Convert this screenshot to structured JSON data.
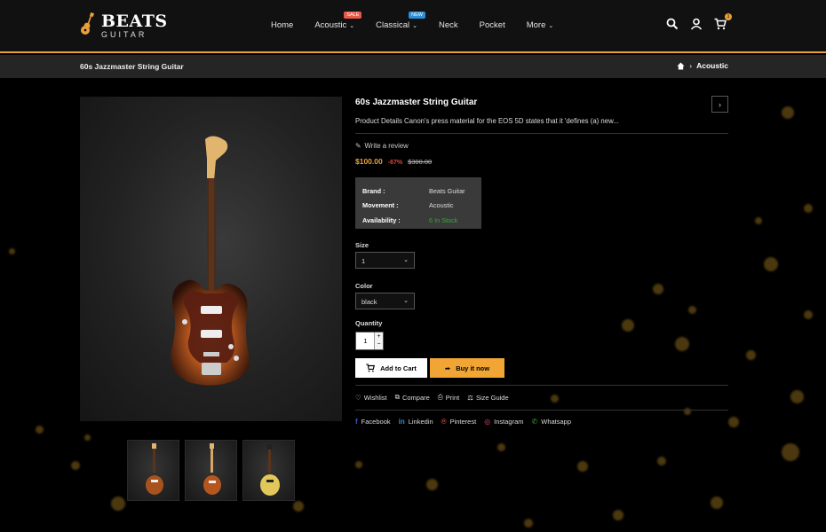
{
  "brand": {
    "name_top": "BEATS",
    "name_bottom": "GUITAR"
  },
  "nav": {
    "items": [
      {
        "label": "Home"
      },
      {
        "label": "Acoustic",
        "badge": "Sale"
      },
      {
        "label": "Classical",
        "badge": "New"
      },
      {
        "label": "Neck"
      },
      {
        "label": "Pocket"
      },
      {
        "label": "More"
      }
    ],
    "cart_count": "1"
  },
  "breadcrumb": {
    "page_title": "60s Jazzmaster String Guitar",
    "current": "Acoustic"
  },
  "product": {
    "title": "60s Jazzmaster String Guitar",
    "description": "Product Details Canon's press material for the EOS 5D states that it 'defines (a) new...",
    "review_label": "Write a review",
    "price": "$100.00",
    "discount": "-67%",
    "old_price": "$300.00",
    "specs": [
      {
        "key": "Brand :",
        "value": "Beats Guitar"
      },
      {
        "key": "Movement :",
        "value": "Acoustic"
      },
      {
        "key": "Availability :",
        "value": "6 In Stock"
      }
    ],
    "size_label": "Size",
    "size_value": "1",
    "color_label": "Color",
    "color_value": "black",
    "quantity_label": "Quantity",
    "quantity_value": "1",
    "add_to_cart": "Add to Cart",
    "buy_now": "Buy it now",
    "actions": [
      "Wishlist",
      "Compare",
      "Print",
      "Size Guide"
    ],
    "social": [
      "Facebook",
      "Linkedin",
      "Pinterest",
      "Instagram",
      "Whatsapp"
    ]
  },
  "colors": {
    "accent": "#e9a13a",
    "discount": "#e0453a",
    "in_stock": "#3aa63a",
    "sale_badge": "#e8584a",
    "new_badge": "#2a8fd6"
  }
}
